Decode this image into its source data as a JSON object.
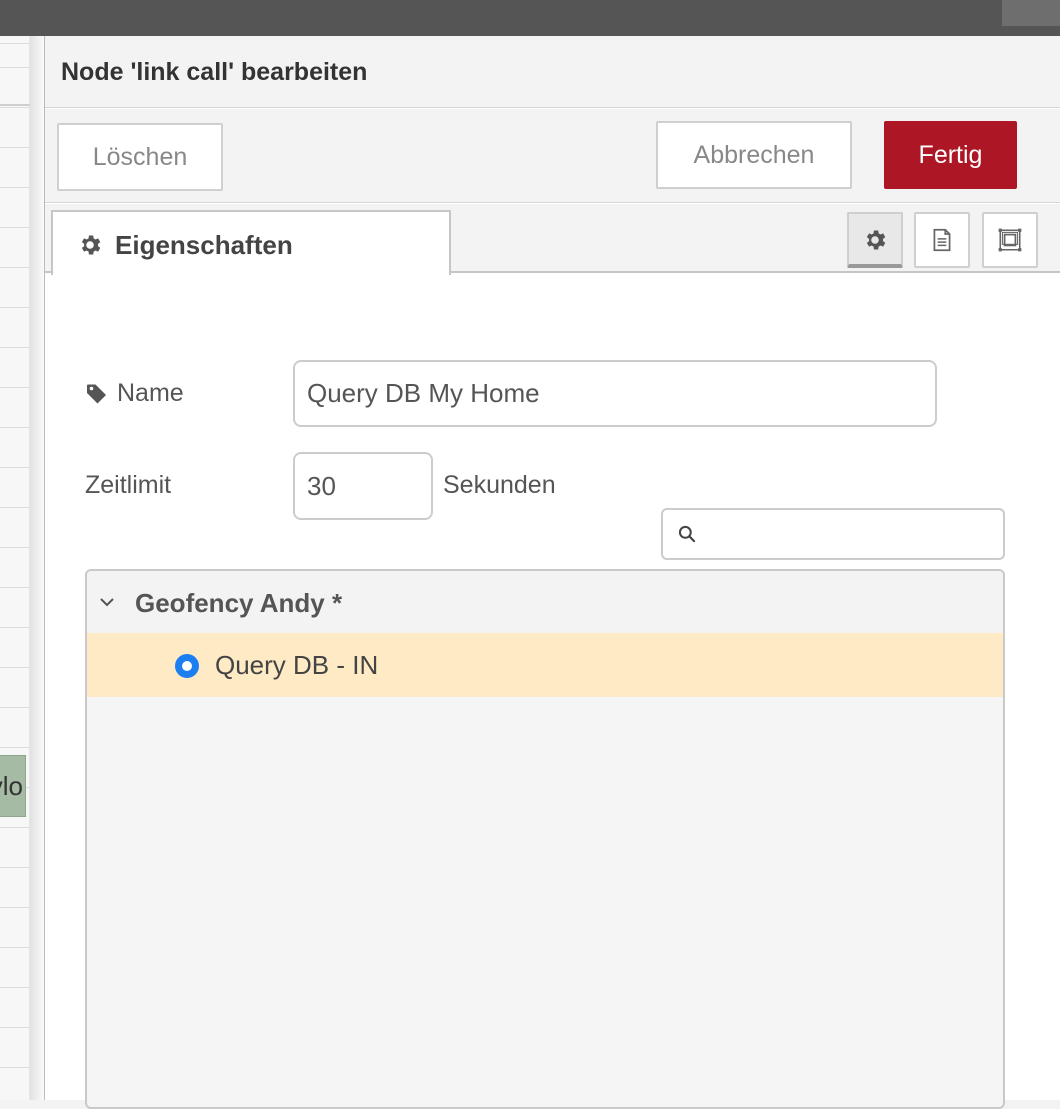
{
  "workspace": {
    "node_fragment": "aylo"
  },
  "tray": {
    "title": "Node 'link call' bearbeiten",
    "toolbar": {
      "delete_label": "Löschen",
      "cancel_label": "Abbrechen",
      "done_label": "Fertig"
    },
    "tabs": [
      {
        "label": "Eigenschaften",
        "icon": "gear-icon",
        "active": true
      }
    ],
    "tab_buttons": [
      {
        "icon": "gear-icon",
        "active": true
      },
      {
        "icon": "description-icon",
        "active": false
      },
      {
        "icon": "appearance-icon",
        "active": false
      }
    ]
  },
  "form": {
    "name": {
      "label": "Name",
      "icon": "tag-icon",
      "value": "Query DB My Home"
    },
    "timeout": {
      "label": "Zeitlimit",
      "value": "30",
      "unit": "Sekunden"
    },
    "search": {
      "icon": "search-icon",
      "value": ""
    }
  },
  "tree": {
    "group": {
      "label": "Geofency Andy *",
      "icon": "chevron-down-icon"
    },
    "items": [
      {
        "label": "Query DB - IN",
        "selected": true
      }
    ]
  },
  "colors": {
    "primary": "#ad1625",
    "selection_bg": "#feebc6",
    "radio": "#1b7ff2",
    "topbar": "#555555"
  }
}
